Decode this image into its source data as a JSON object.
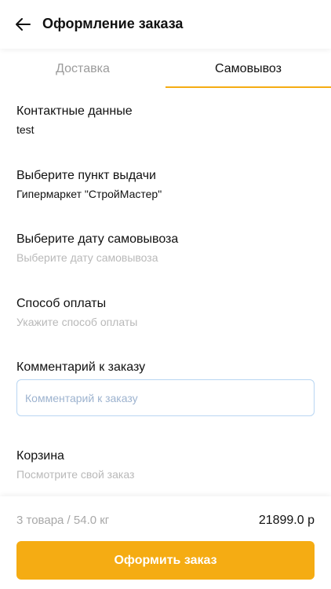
{
  "header": {
    "title": "Оформление заказа",
    "back_icon": "arrow-left-icon"
  },
  "tabs": [
    {
      "label": "Доставка",
      "active": false
    },
    {
      "label": "Самовывоз",
      "active": true
    }
  ],
  "contact": {
    "title": "Контактные данные",
    "value": "test"
  },
  "pickup_point": {
    "title": "Выберите пункт выдачи",
    "value": "Гипермаркет \"СтройМастер\""
  },
  "pickup_date": {
    "title": "Выберите дату самовывоза",
    "placeholder": "Выберите дату самовывоза"
  },
  "payment": {
    "title": "Способ оплаты",
    "placeholder": "Укажите способ оплаты"
  },
  "comment": {
    "title": "Комментарий к заказу",
    "placeholder": "Комментарий к заказу"
  },
  "cart": {
    "title": "Корзина",
    "placeholder": "Посмотрите свой заказ"
  },
  "footer": {
    "summary": "3 товара / 54.0 кг",
    "total": "21899.0 р",
    "button_label": "Оформить заказ"
  },
  "colors": {
    "accent": "#f5ac13",
    "muted": "#b9b9b9",
    "input_border": "#b9d6f2"
  }
}
